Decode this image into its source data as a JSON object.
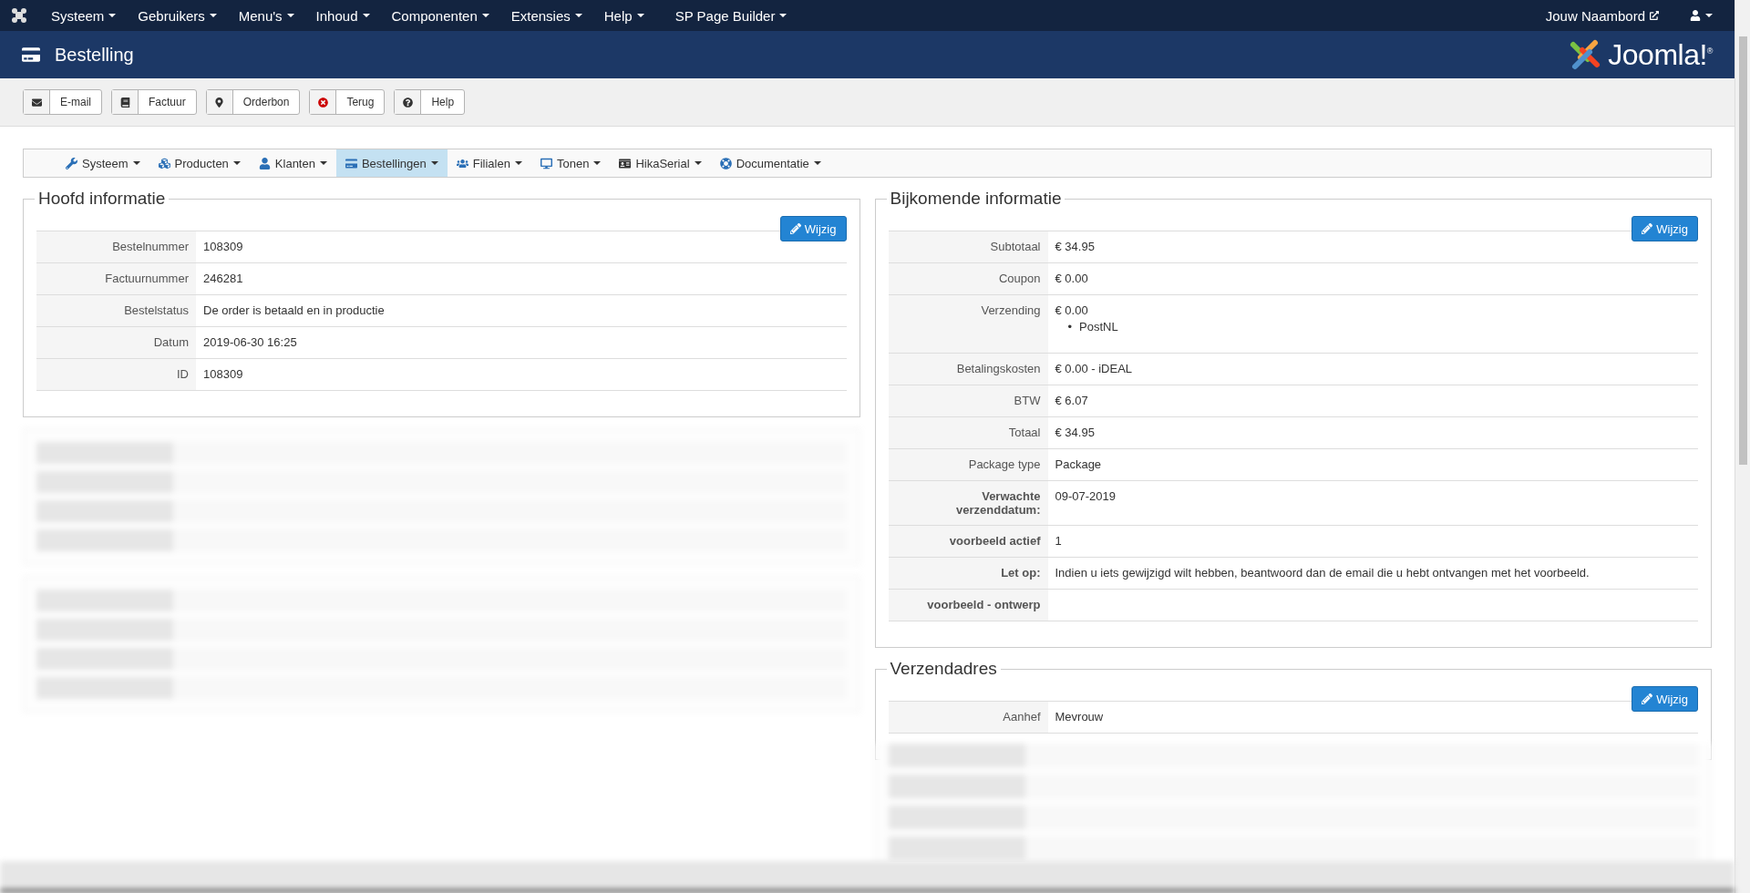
{
  "top_menu": {
    "items": [
      {
        "label": "Systeem"
      },
      {
        "label": "Gebruikers"
      },
      {
        "label": "Menu's"
      },
      {
        "label": "Inhoud"
      },
      {
        "label": "Componenten"
      },
      {
        "label": "Extensies"
      },
      {
        "label": "Help"
      },
      {
        "label": "SP Page Builder"
      }
    ],
    "site_link": "Jouw Naambord"
  },
  "header": {
    "title": "Bestelling",
    "logo_text": "Joomla!$^{®}$"
  },
  "toolbar": [
    {
      "label": "E-mail"
    },
    {
      "label": "Factuur"
    },
    {
      "label": "Orderbon"
    },
    {
      "label": "Terug"
    },
    {
      "label": "Help"
    }
  ],
  "submenu": [
    {
      "label": "Systeem",
      "selected": false
    },
    {
      "label": "Producten",
      "selected": false
    },
    {
      "label": "Klanten",
      "selected": false
    },
    {
      "label": "Bestellingen",
      "selected": true
    },
    {
      "label": "Filialen",
      "selected": false
    },
    {
      "label": "Tonen",
      "selected": false
    },
    {
      "label": "HikaSerial",
      "selected": false
    },
    {
      "label": "Documentatie",
      "selected": false
    }
  ],
  "left_column": [
    {
      "kind": "panel",
      "title": "Hoofd informatie",
      "button": "Wijzig",
      "rows": [
        {
          "label": "Bestelnummer",
          "value": "108309",
          "bold": false
        },
        {
          "label": "Factuurnummer",
          "value": "246281",
          "bold": false
        },
        {
          "label": "Bestelstatus",
          "value": "De order is betaald en in productie",
          "bold": false
        },
        {
          "label": "Datum",
          "value": "2019-06-30 16:25",
          "bold": false
        },
        {
          "label": "ID",
          "value": "108309",
          "bold": false
        }
      ]
    },
    {
      "kind": "blurred"
    },
    {
      "kind": "blurred"
    }
  ],
  "right_column": [
    {
      "kind": "panel",
      "title": "Bijkomende informatie",
      "button": "Wijzig",
      "rows": [
        {
          "label": "Subtotaal",
          "value": "€ 34.95",
          "bold": false
        },
        {
          "label": "Coupon",
          "value": "€ 0.00",
          "bold": false
        },
        {
          "label": "Verzending",
          "value": "€ 0.00",
          "sub_items": [
            {
              "marker": "•",
              "text": "PostNL"
            }
          ],
          "bold": false
        },
        {
          "label": "Betalingskosten",
          "value": "€ 0.00 - iDEAL",
          "bold": false
        },
        {
          "label": "BTW",
          "value": "€ 6.07",
          "bold": false
        },
        {
          "label": "Totaal",
          "value": "€ 34.95",
          "bold": false
        },
        {
          "label": "Package type",
          "value": "Package",
          "bold": false
        },
        {
          "label": "Verwachte verzenddatum:",
          "value": "09-07-2019",
          "bold": true
        },
        {
          "label": "voorbeeld actief",
          "value": "1",
          "bold": true
        },
        {
          "label": "Let op:",
          "value": "Indien u iets gewijzigd wilt hebben, beantwoord dan de email die u hebt ontvangen met het voorbeeld.",
          "bold": true
        },
        {
          "label": "voorbeeld - ontwerp",
          "value": "",
          "bold": true
        }
      ]
    },
    {
      "kind": "panel",
      "title": "Verzendadres",
      "button": "Wijzig",
      "rows": [
        {
          "label": "Aanhef",
          "value": "Mevrouw",
          "bold": false
        }
      ]
    },
    {
      "kind": "blurred_rows"
    }
  ]
}
